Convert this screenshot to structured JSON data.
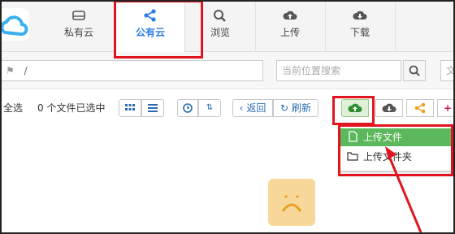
{
  "nav": {
    "tabs": [
      {
        "label": "私有云",
        "icon": "hdd-icon"
      },
      {
        "label": "公有云",
        "icon": "share-icon",
        "active": true
      },
      {
        "label": "浏览",
        "icon": "search-icon"
      },
      {
        "label": "上传",
        "icon": "cloud-upload-icon"
      },
      {
        "label": "下载",
        "icon": "cloud-download-icon"
      }
    ]
  },
  "path": {
    "value": "/",
    "home_icon": "home-icon"
  },
  "search": {
    "placeholder": "当前位置搜索",
    "extra_placeholder": "文"
  },
  "toolbar": {
    "select_all": "全选",
    "selected_count": "0 个文件已选中",
    "back": "返回",
    "refresh": "刷新"
  },
  "dropdown": {
    "upload_file": "上传文件",
    "upload_folder": "上传文件夹"
  },
  "colors": {
    "accent": "#2b7de9",
    "highlight": "#5cb85c",
    "annotation": "#e0151f"
  }
}
